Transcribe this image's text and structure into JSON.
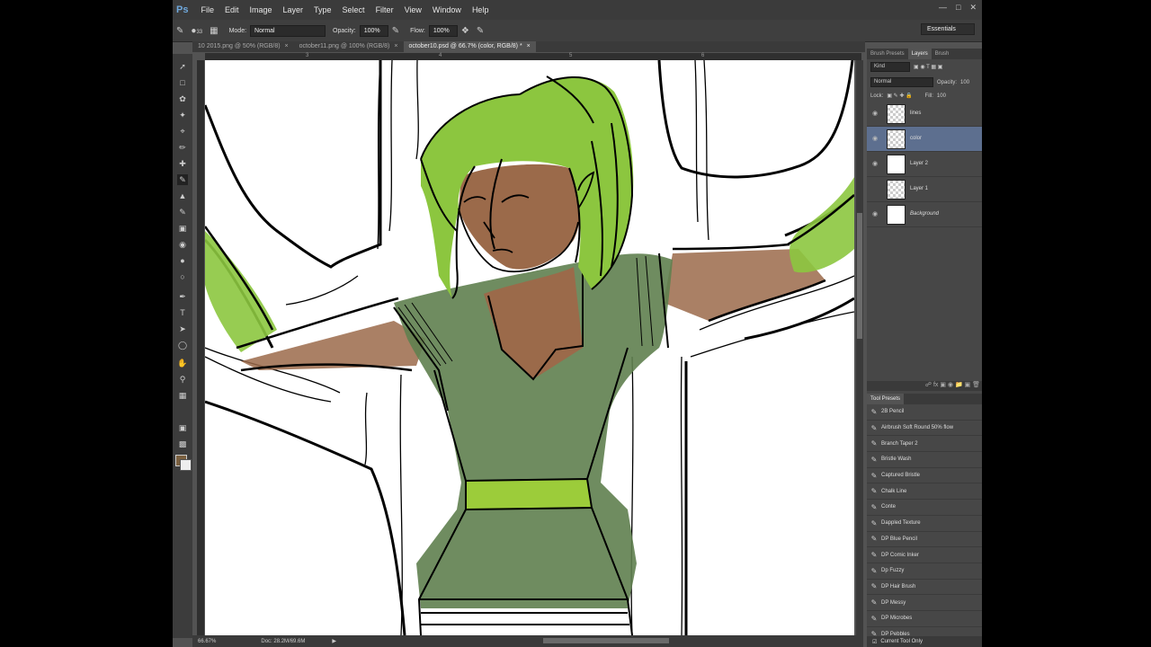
{
  "menu": {
    "logo": "Ps",
    "items": [
      "File",
      "Edit",
      "Image",
      "Layer",
      "Type",
      "Select",
      "Filter",
      "View",
      "Window",
      "Help"
    ]
  },
  "options": {
    "brush_size": "33",
    "mode_label": "Mode:",
    "mode_value": "Normal",
    "opacity_label": "Opacity:",
    "opacity_value": "100%",
    "flow_label": "Flow:",
    "flow_value": "100%",
    "workspace": "Essentials"
  },
  "tabs": [
    {
      "label": "10 2015.png @ 50% (RGB/8)",
      "active": false
    },
    {
      "label": "october11.png @ 100% (RGB/8)",
      "active": false
    },
    {
      "label": "october10.psd @ 66.7% (color, RGB/8) *",
      "active": true
    }
  ],
  "ruler_ticks": [
    "3",
    "4",
    "5",
    "6"
  ],
  "status": {
    "zoom": "66.67%",
    "doc": "Doc: 28.2M/69.6M"
  },
  "colors": {
    "foreground": "#7a6040",
    "background": "#eeeeee",
    "hair": "#8cc63f",
    "skin": "#9b6a4a",
    "dress": "#5f7f4f",
    "belt": "#9ccc3a"
  },
  "panels": {
    "tabs": [
      "Brush Presets",
      "Layers",
      "Brush"
    ],
    "active_tab": "Layers",
    "kind_label": "Kind",
    "blend_mode": "Normal",
    "opacity_label": "Opacity:",
    "opacity_value": "100",
    "lock_label": "Lock:",
    "fill_label": "Fill:",
    "fill_value": "100"
  },
  "layers": [
    {
      "name": "lines",
      "visible": true,
      "selected": false,
      "checker": true,
      "italic": false
    },
    {
      "name": "color",
      "visible": true,
      "selected": true,
      "checker": true,
      "italic": false
    },
    {
      "name": "Layer 2",
      "visible": true,
      "selected": false,
      "checker": false,
      "italic": false
    },
    {
      "name": "Layer 1",
      "visible": false,
      "selected": false,
      "checker": true,
      "italic": false
    },
    {
      "name": "Background",
      "visible": true,
      "selected": false,
      "checker": false,
      "italic": true
    }
  ],
  "tool_presets": {
    "title": "Tool Presets",
    "items": [
      "2B Pencil",
      "Airbrush Soft Round 50% flow",
      "Branch Taper 2",
      "Bristle Wash",
      "Captured Bristle",
      "Chalk Line",
      "Conte",
      "Dappled Texture",
      "DP Blue Pencil",
      "DP Comic Inker",
      "Dp Fuzzy",
      "DP Hair Brush",
      "DP Messy",
      "DP Microbes",
      "DP Pebbles"
    ],
    "footer": "Current Tool Only"
  },
  "icons": {
    "eye": "eye-icon",
    "brush": "brush-icon",
    "close": "close-icon"
  }
}
